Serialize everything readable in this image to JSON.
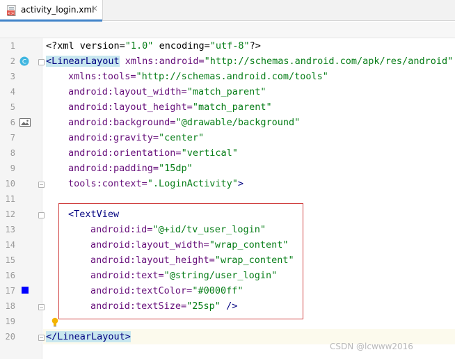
{
  "tab": {
    "title": "activity_login.xml",
    "close": "×"
  },
  "gutter": {
    "line_numbers": [
      "1",
      "2",
      "3",
      "4",
      "5",
      "6",
      "7",
      "8",
      "9",
      "10",
      "11",
      "12",
      "13",
      "14",
      "15",
      "16",
      "17",
      "18",
      "19",
      "20"
    ],
    "class_badge": "C",
    "color_swatch": "#0000ff"
  },
  "code": {
    "l1": {
      "a": "<?xml version=",
      "b": "\"1.0\"",
      "c": " encoding=",
      "d": "\"utf-8\"",
      "e": "?>"
    },
    "l2": {
      "a": "<LinearLayout",
      "b": " xmlns:android=",
      "c": "\"http://schemas.android.com/apk/res/android\""
    },
    "l3": {
      "a": "xmlns:tools=",
      "b": "\"http://schemas.android.com/tools\""
    },
    "l4": {
      "a": "android:layout_width=",
      "b": "\"match_parent\""
    },
    "l5": {
      "a": "android:layout_height=",
      "b": "\"match_parent\""
    },
    "l6": {
      "a": "android:background=",
      "b": "\"@drawable/background\""
    },
    "l7": {
      "a": "android:gravity=",
      "b": "\"center\""
    },
    "l8": {
      "a": "android:orientation=",
      "b": "\"vertical\""
    },
    "l9": {
      "a": "android:padding=",
      "b": "\"15dp\""
    },
    "l10": {
      "a": "tools:context=",
      "b": "\".LoginActivity\"",
      "c": ">"
    },
    "l12": {
      "a": "<TextView"
    },
    "l13": {
      "a": "android:id=",
      "b": "\"@+id/tv_user_login\""
    },
    "l14": {
      "a": "android:layout_width=",
      "b": "\"wrap_content\""
    },
    "l15": {
      "a": "android:layout_height=",
      "b": "\"wrap_content\""
    },
    "l16": {
      "a": "android:text=",
      "b": "\"@string/user_login\""
    },
    "l17": {
      "a": "android:textColor=",
      "b": "\"#0000ff\""
    },
    "l18": {
      "a": "android:textSize=",
      "b": "\"25sp\"",
      "c": " />"
    },
    "l20": {
      "a": "</LinearLayout>"
    }
  },
  "watermark": "CSDN @lcwww2016"
}
